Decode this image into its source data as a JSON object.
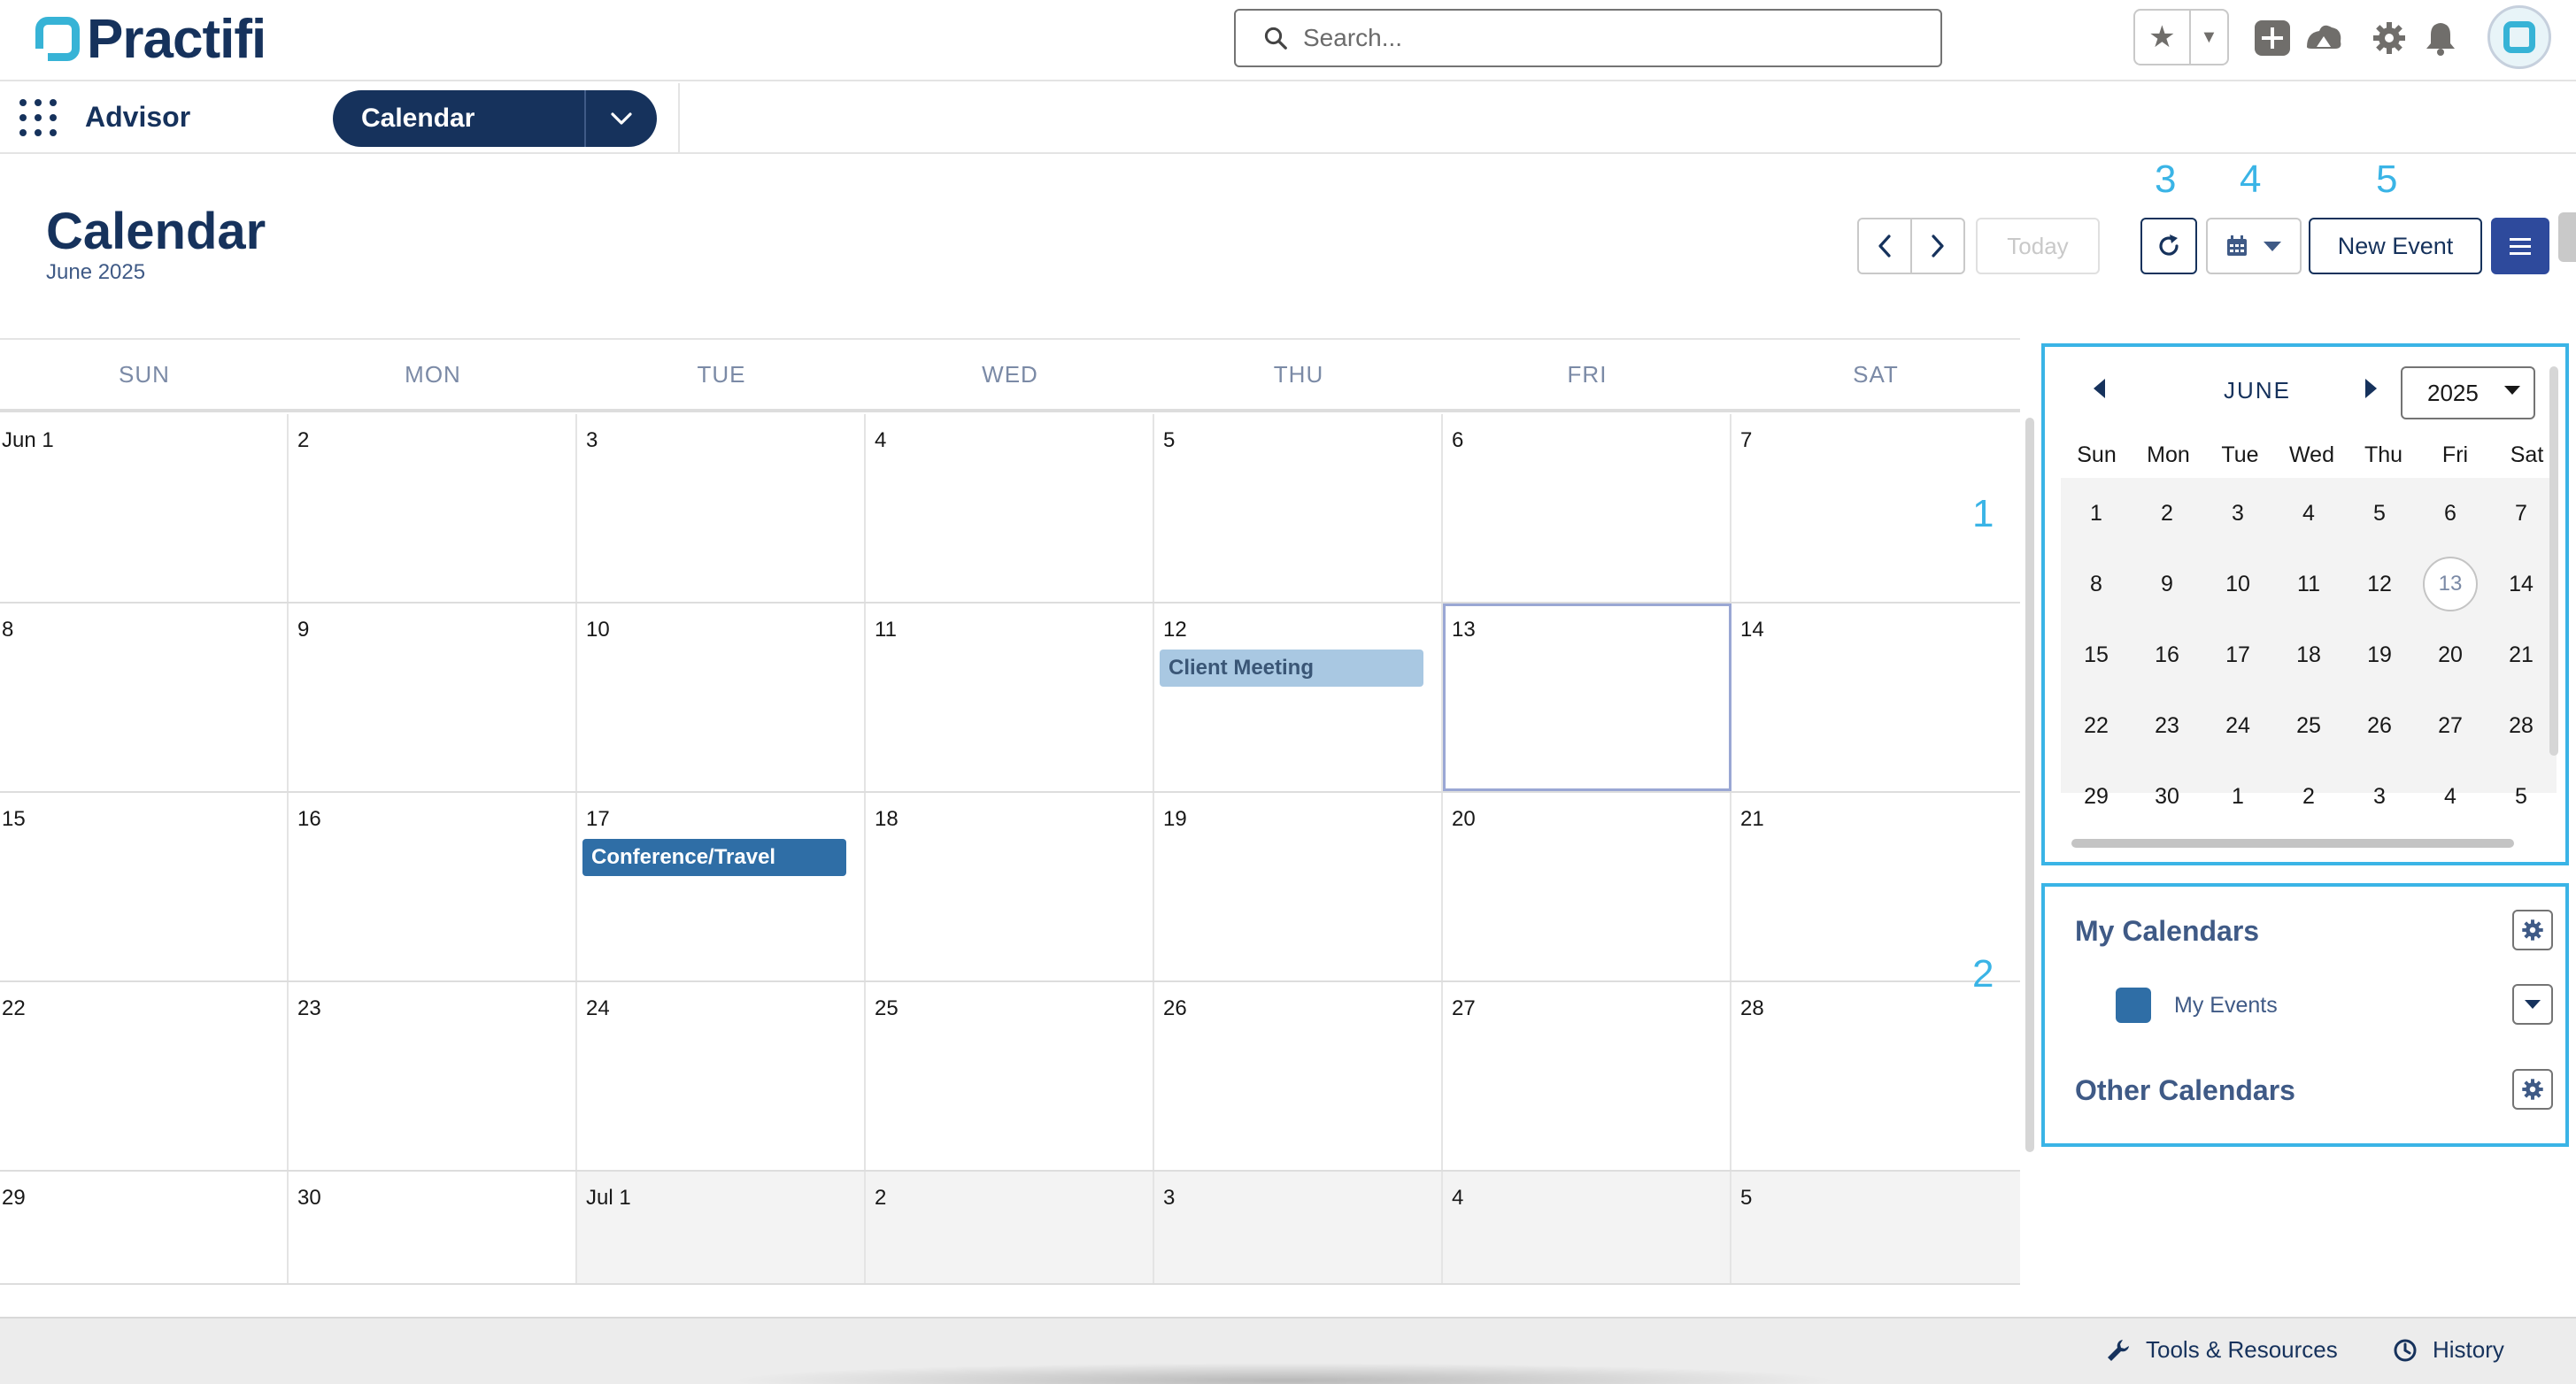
{
  "brand": {
    "name": "Practifi"
  },
  "search": {
    "placeholder": "Search..."
  },
  "nav": {
    "app_name": "Advisor",
    "tab_label": "Calendar"
  },
  "page": {
    "title": "Calendar",
    "subtitle": "June 2025"
  },
  "markers": [
    "1",
    "2",
    "3",
    "4",
    "5"
  ],
  "toolbar": {
    "today_label": "Today",
    "new_event_label": "New Event"
  },
  "calendar": {
    "weekdays": [
      "SUN",
      "MON",
      "TUE",
      "WED",
      "THU",
      "FRI",
      "SAT"
    ],
    "weeks": [
      [
        "Jun 1",
        "2",
        "3",
        "4",
        "5",
        "6",
        "7"
      ],
      [
        "8",
        "9",
        "10",
        "11",
        "12",
        "13",
        "14"
      ],
      [
        "15",
        "16",
        "17",
        "18",
        "19",
        "20",
        "21"
      ],
      [
        "22",
        "23",
        "24",
        "25",
        "26",
        "27",
        "28"
      ],
      [
        "29",
        "30",
        "Jul 1",
        "2",
        "3",
        "4",
        "5"
      ]
    ],
    "events": [
      {
        "label": "Client Meeting",
        "week": 1,
        "day": 4,
        "style": "light"
      },
      {
        "label": "Conference/Travel",
        "week": 2,
        "day": 2,
        "style": "dark"
      }
    ]
  },
  "mini_calendar": {
    "month": "JUNE",
    "year": "2025",
    "weekdays": [
      "Sun",
      "Mon",
      "Tue",
      "Wed",
      "Thu",
      "Fri",
      "Sat"
    ],
    "weeks": [
      [
        "1",
        "2",
        "3",
        "4",
        "5",
        "6",
        "7"
      ],
      [
        "8",
        "9",
        "10",
        "11",
        "12",
        "13",
        "14"
      ],
      [
        "15",
        "16",
        "17",
        "18",
        "19",
        "20",
        "21"
      ],
      [
        "22",
        "23",
        "24",
        "25",
        "26",
        "27",
        "28"
      ],
      [
        "29",
        "30",
        "1",
        "2",
        "3",
        "4",
        "5"
      ]
    ],
    "today": "13"
  },
  "calendars_panel": {
    "my_calendars_title": "My Calendars",
    "my_events_label": "My Events",
    "other_calendars_title": "Other Calendars"
  },
  "footer": {
    "tools_label": "Tools & Resources",
    "history_label": "History"
  },
  "colors": {
    "brand_navy": "#16325c",
    "accent_cyan": "#3ab4e6",
    "event_light": "#a9c8e2",
    "event_dark": "#2f6ea6"
  }
}
